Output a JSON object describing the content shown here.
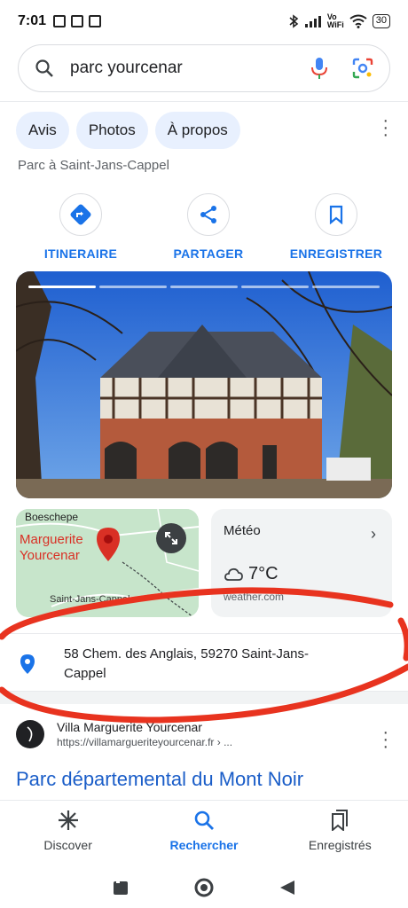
{
  "status": {
    "time": "7:01",
    "battery": "30",
    "vowifi_label": "Vo\nWiFi"
  },
  "search": {
    "query": "parc yourcenar"
  },
  "chips": [
    "Avis",
    "Photos",
    "À propos"
  ],
  "place": {
    "type": "Parc à Saint-Jans-Cappel"
  },
  "actions": {
    "directions": "ITINERAIRE",
    "share": "PARTAGER",
    "save": "ENREGISTRER"
  },
  "map": {
    "town": "Boeschepe",
    "name_line1": "Marguerite",
    "name_line2": "Yourcenar",
    "bottom_label": "Saint-Jans-Cappel"
  },
  "weather": {
    "title": "Météo",
    "temperature": "7°C",
    "source": "weather.com"
  },
  "address": {
    "line1": "58 Chem. des Anglais, 59270 Saint-Jans-",
    "line2": "Cappel"
  },
  "result": {
    "site_name": "Villa Marguerite Yourcenar",
    "url": "https://villamargueriteyourcenar.fr › ..."
  },
  "next_result_title": "Parc départemental du Mont Noir",
  "bottom_nav": {
    "discover": "Discover",
    "search": "Rechercher",
    "saved": "Enregistrés"
  },
  "colors": {
    "accent": "#1a73e8",
    "chip_bg": "#e8f0fe",
    "annotation": "#e8331f",
    "pin": "#d93025"
  }
}
